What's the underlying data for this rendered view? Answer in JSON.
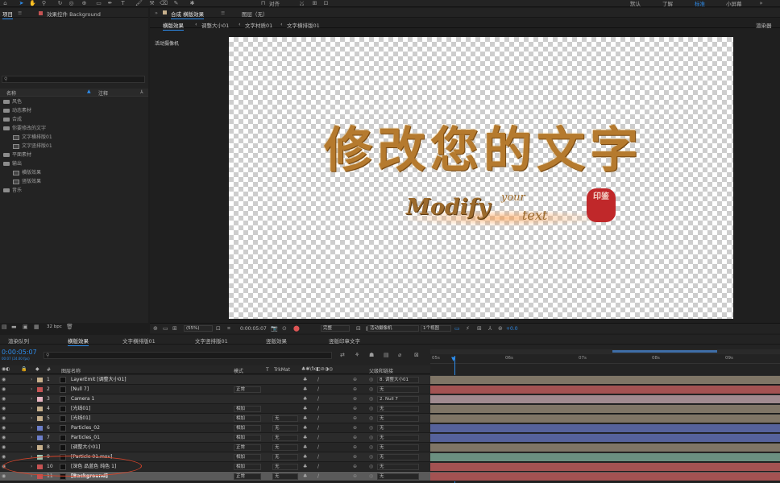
{
  "workspaces": [
    "默认",
    "了解",
    "标准",
    "小屏幕"
  ],
  "active_workspace": "标准",
  "toolbar": {
    "align_label": "对齐"
  },
  "project_panel": {
    "tab_project": "项目",
    "tab_effects": "效果控件 Background",
    "search_placeholder": "",
    "col_name": "名称",
    "col_comment": "注释",
    "items": [
      {
        "type": "folder",
        "label": "风色",
        "indent": 0
      },
      {
        "type": "folder",
        "label": "动态素材",
        "indent": 0
      },
      {
        "type": "folder",
        "label": "合成",
        "indent": 0
      },
      {
        "type": "folder",
        "label": "你要修改的文字",
        "indent": 0
      },
      {
        "type": "comp",
        "label": "文字横排版01",
        "indent": 1
      },
      {
        "type": "comp",
        "label": "文字竖排版01",
        "indent": 1
      },
      {
        "type": "folder",
        "label": "平面素材",
        "indent": 0
      },
      {
        "type": "folder",
        "label": "输出",
        "indent": 0
      },
      {
        "type": "comp",
        "label": "横版效果",
        "indent": 1
      },
      {
        "type": "comp",
        "label": "竖版效果",
        "indent": 1
      },
      {
        "type": "folder",
        "label": "音乐",
        "indent": 0
      }
    ],
    "bpc": "32 bpc"
  },
  "comp_panel": {
    "tab_comp": "合成 横版效果",
    "tab_layer": "图层（无）",
    "breadcrumbs": [
      "横版效果",
      "调整大小01",
      "文字材质01",
      "文字横排版01"
    ],
    "renderer": "渲染器",
    "active_camera_label": "活动摄像机",
    "art_title": "修改您的文字",
    "art_modify": "Modify",
    "art_your": "your",
    "art_text": "text",
    "art_seal": "印鉴",
    "zoom": "(55%)",
    "timecode": "0:00:05:07",
    "resolution": "完整",
    "camera": "活动摄像机",
    "views": "1个视图",
    "exposure": "+0.0"
  },
  "timeline": {
    "tabs": [
      "渲染队列",
      "横版效果",
      "文字横排版01",
      "文字竖排版01",
      "竖版效果",
      "竖版印章文字"
    ],
    "active_tab": "横版效果",
    "current_time": "0:00:05:07",
    "fps": "00:07 (24.00 fps)",
    "col_layer_name": "图层名称",
    "col_mode": "模式",
    "col_t": "T",
    "col_trkmat": "TrkMat",
    "col_parent": "父级和链接",
    "ruler": [
      "05s",
      "06s",
      "07s",
      "08s",
      "09s"
    ],
    "layers": [
      {
        "num": "1",
        "name": "LayerEmit [调整大小01]",
        "color": "#c7b08c",
        "mode": "",
        "trk": "",
        "parent": "8. 调整大小01",
        "bar": "#7f7566"
      },
      {
        "num": "2",
        "name": "[Null 7]",
        "color": "#c65353",
        "mode": "正常",
        "trk": "",
        "parent": "无",
        "bar": "#a35252"
      },
      {
        "num": "3",
        "name": "Camera 1",
        "color": "#e8b4c0",
        "mode": "",
        "trk": "",
        "parent": "2. Null 7",
        "bar": "#a08a8f"
      },
      {
        "num": "4",
        "name": "[光线01]",
        "color": "#c7b08c",
        "mode": "相加",
        "trk": "",
        "parent": "无",
        "bar": "#7f7566"
      },
      {
        "num": "5",
        "name": "[光线01]",
        "color": "#c7b08c",
        "mode": "相加",
        "trk": "无",
        "parent": "无",
        "bar": "#7f7566"
      },
      {
        "num": "6",
        "name": "Particles_02",
        "color": "#6c7ec9",
        "mode": "相加",
        "trk": "无",
        "parent": "无",
        "bar": "#56629b"
      },
      {
        "num": "7",
        "name": "Particles_01",
        "color": "#6c7ec9",
        "mode": "相加",
        "trk": "无",
        "parent": "无",
        "bar": "#56629b"
      },
      {
        "num": "8",
        "name": "[调整大小01]",
        "color": "#c7b08c",
        "mode": "正常",
        "trk": "无",
        "parent": "无",
        "bar": "#7f7566"
      },
      {
        "num": "9",
        "name": "[Particle 01.mov]",
        "color": "#9fc7b4",
        "mode": "相加",
        "trk": "无",
        "parent": "无",
        "bar": "#6b8f80"
      },
      {
        "num": "10",
        "name": "[深色 品蓝色 纯色 1]",
        "color": "#c65353",
        "mode": "相加",
        "trk": "无",
        "parent": "无",
        "bar": "#a35252"
      },
      {
        "num": "11",
        "name": "[Background]",
        "color": "#c65353",
        "mode": "正常",
        "trk": "无",
        "parent": "无",
        "bar": "#a35252"
      }
    ]
  }
}
